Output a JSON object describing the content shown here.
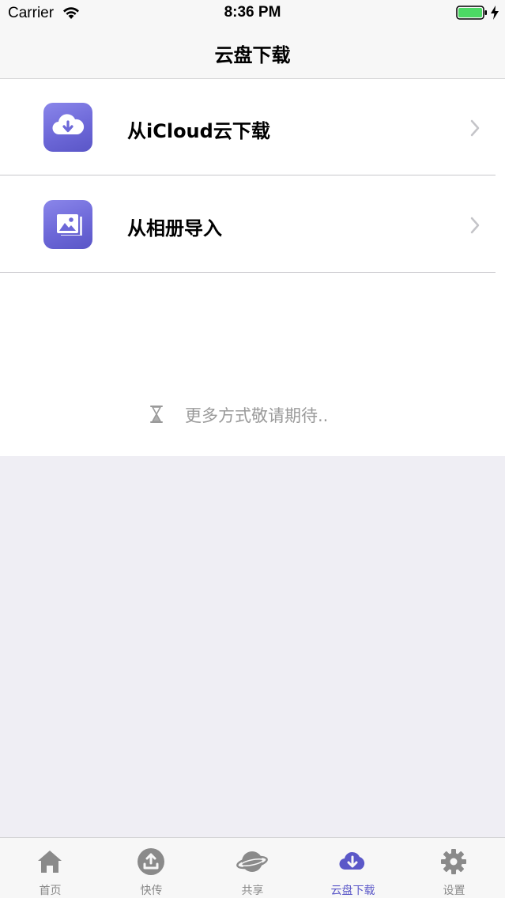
{
  "status_bar": {
    "carrier": "Carrier",
    "time": "8:36 PM"
  },
  "nav": {
    "title": "云盘下载"
  },
  "rows": [
    {
      "label": "从iCloud云下载",
      "icon": "cloud-download-icon"
    },
    {
      "label": "从相册导入",
      "icon": "photo-album-icon"
    }
  ],
  "more_hint": {
    "text": "更多方式敬请期待..",
    "icon": "hourglass-icon"
  },
  "tabs": [
    {
      "label": "首页",
      "icon": "home-icon",
      "active": false
    },
    {
      "label": "快传",
      "icon": "upload-icon",
      "active": false
    },
    {
      "label": "共享",
      "icon": "planet-icon",
      "active": false
    },
    {
      "label": "云盘下载",
      "icon": "cloud-download-icon",
      "active": true
    },
    {
      "label": "设置",
      "icon": "gear-icon",
      "active": false
    }
  ],
  "colors": {
    "accent": "#5b58c8",
    "icon_gradient_start": "#8a86ea",
    "icon_gradient_end": "#5a56c7",
    "inactive_tab": "#8a8a8a",
    "background": "#efeef4",
    "battery": "#4cd964"
  }
}
